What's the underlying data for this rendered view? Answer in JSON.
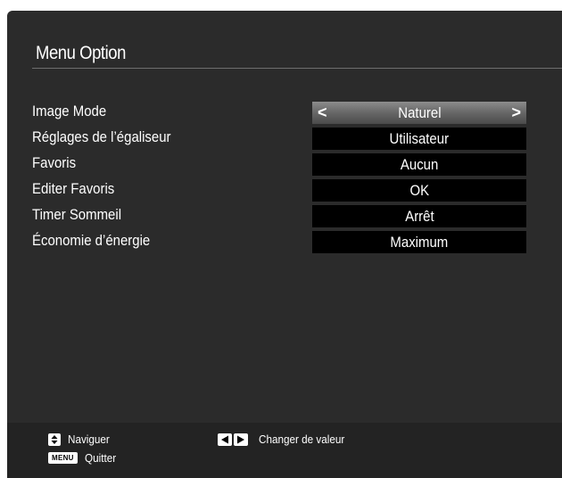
{
  "menu": {
    "title": "Menu Option"
  },
  "settings": [
    {
      "label": "Image Mode",
      "value": "Naturel",
      "selected": true
    },
    {
      "label": "Réglages de l’égaliseur",
      "value": "Utilisateur",
      "selected": false
    },
    {
      "label": "Favoris",
      "value": "Aucun",
      "selected": false
    },
    {
      "label": "Editer Favoris",
      "value": "OK",
      "selected": false
    },
    {
      "label": "Timer Sommeil",
      "value": "Arrêt",
      "selected": false
    },
    {
      "label": "Économie d’énergie",
      "value": "Maximum",
      "selected": false
    }
  ],
  "arrows": {
    "left_glyph": "<",
    "right_glyph": ">"
  },
  "footer": {
    "navigate": "Naviguer",
    "change_value": "Changer de valeur",
    "menu_key": "MENU",
    "quit": "Quitter"
  },
  "colors": {
    "background": "#2b2b2b",
    "value_box": "#000000",
    "selected_box": "#7a7a7a",
    "text": "#ffffff"
  }
}
